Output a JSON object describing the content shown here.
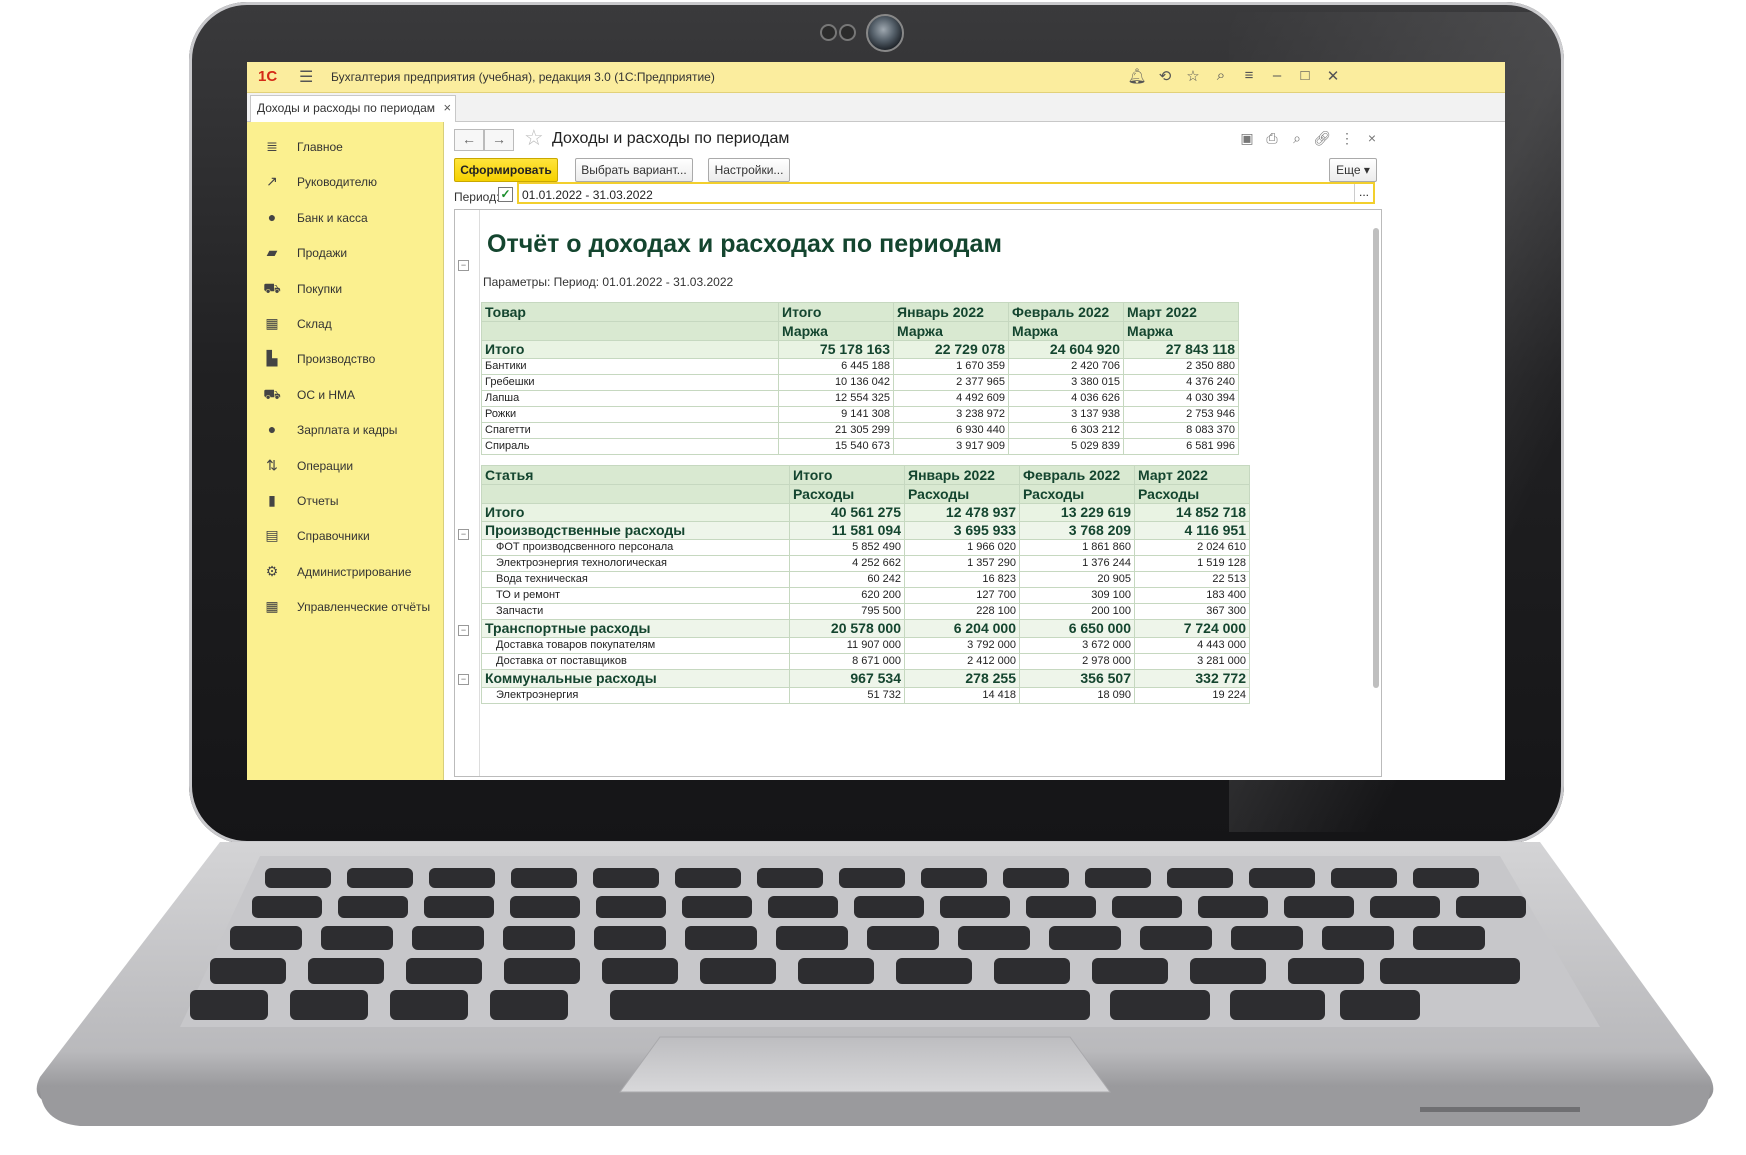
{
  "app": {
    "logo": "1С",
    "title": "Бухгалтерия предприятия (учебная), редакция 3.0  (1С:Предприятие)",
    "titlebar_icons": [
      "bell-icon",
      "history-icon",
      "star-icon",
      "search-icon",
      "filter-icon",
      "minimize-icon",
      "maximize-icon",
      "close-icon"
    ]
  },
  "tab": {
    "label": "Доходы и расходы по периодам",
    "close": "×"
  },
  "sidebar": {
    "items": [
      {
        "label": "Главное",
        "icon": "menu-icon"
      },
      {
        "label": "Руководителю",
        "icon": "trend-icon"
      },
      {
        "label": "Банк и касса",
        "icon": "coin-icon"
      },
      {
        "label": "Продажи",
        "icon": "bag-icon"
      },
      {
        "label": "Покупки",
        "icon": "cart-icon"
      },
      {
        "label": "Склад",
        "icon": "warehouse-icon"
      },
      {
        "label": "Производство",
        "icon": "factory-icon"
      },
      {
        "label": "ОС и НМА",
        "icon": "truck-icon"
      },
      {
        "label": "Зарплата и кадры",
        "icon": "person-icon"
      },
      {
        "label": "Операции",
        "icon": "debit-credit-icon"
      },
      {
        "label": "Отчеты",
        "icon": "bar-chart-icon"
      },
      {
        "label": "Справочники",
        "icon": "book-icon"
      },
      {
        "label": "Администрирование",
        "icon": "gear-icon"
      },
      {
        "label": "Управленческие отчёты",
        "icon": "calculator-icon"
      }
    ]
  },
  "form": {
    "title": "Доходы и расходы по периодам",
    "btn_generate": "Сформировать",
    "btn_variant": "Выбрать вариант...",
    "btn_settings": "Настройки...",
    "btn_more": "Еще",
    "period_label": "Период:",
    "period_value": "01.01.2022 - 31.03.2022",
    "period_dots": "..."
  },
  "report": {
    "title": "Отчёт о доходах и расходах по периодам",
    "params": "Параметры:  Период: 01.01.2022 - 31.03.2022",
    "table1": {
      "head1": [
        "Товар",
        "Итого",
        "Январь 2022",
        "Февраль 2022",
        "Март 2022"
      ],
      "head2": [
        "",
        "Маржа",
        "Маржа",
        "Маржа",
        "Маржа"
      ],
      "total": [
        "Итого",
        "75 178 163",
        "22 729 078",
        "24 604 920",
        "27 843 118"
      ],
      "rows": [
        [
          "Бантики",
          "6 445 188",
          "1 670 359",
          "2 420 706",
          "2 350 880"
        ],
        [
          "Гребешки",
          "10 136 042",
          "2 377 965",
          "3 380 015",
          "4 376 240"
        ],
        [
          "Лапша",
          "12 554 325",
          "4 492 609",
          "4 036 626",
          "4 030 394"
        ],
        [
          "Рожки",
          "9 141 308",
          "3 238 972",
          "3 137 938",
          "2 753 946"
        ],
        [
          "Спагетти",
          "21 305 299",
          "6 930 440",
          "6 303 212",
          "8 083 370"
        ],
        [
          "Спираль",
          "15 540 673",
          "3 917 909",
          "5 029 839",
          "6 581 996"
        ]
      ]
    },
    "table2": {
      "head1": [
        "Статья",
        "Итого",
        "Январь 2022",
        "Февраль 2022",
        "Март 2022"
      ],
      "head2": [
        "",
        "Расходы",
        "Расходы",
        "Расходы",
        "Расходы"
      ],
      "total": [
        "Итого",
        "40 561 275",
        "12 478 937",
        "13 229 619",
        "14 852 718"
      ],
      "groups": [
        {
          "row": [
            "Производственные расходы",
            "11 581 094",
            "3 695 933",
            "3 768 209",
            "4 116 951"
          ],
          "items": [
            [
              "ФОТ производсвенного персонала",
              "5 852 490",
              "1 966 020",
              "1 861 860",
              "2 024 610"
            ],
            [
              "Электроэнергия технологическая",
              "4 252 662",
              "1 357 290",
              "1 376 244",
              "1 519 128"
            ],
            [
              "Вода техническая",
              "60 242",
              "16 823",
              "20 905",
              "22 513"
            ],
            [
              "ТО и ремонт",
              "620 200",
              "127 700",
              "309 100",
              "183 400"
            ],
            [
              "Запчасти",
              "795 500",
              "228 100",
              "200 100",
              "367 300"
            ]
          ]
        },
        {
          "row": [
            "Транспортные расходы",
            "20 578 000",
            "6 204 000",
            "6 650 000",
            "7 724 000"
          ],
          "items": [
            [
              "Доставка товаров покупателям",
              "11 907 000",
              "3 792 000",
              "3 672 000",
              "4 443 000"
            ],
            [
              "Доставка от поставщиков",
              "8 671 000",
              "2 412 000",
              "2 978 000",
              "3 281 000"
            ]
          ]
        },
        {
          "row": [
            "Коммунальные расходы",
            "967 534",
            "278 255",
            "356 507",
            "332 772"
          ],
          "items": [
            [
              "Электроэнергия",
              "51 732",
              "14 418",
              "18 090",
              "19 224"
            ]
          ]
        }
      ]
    }
  }
}
